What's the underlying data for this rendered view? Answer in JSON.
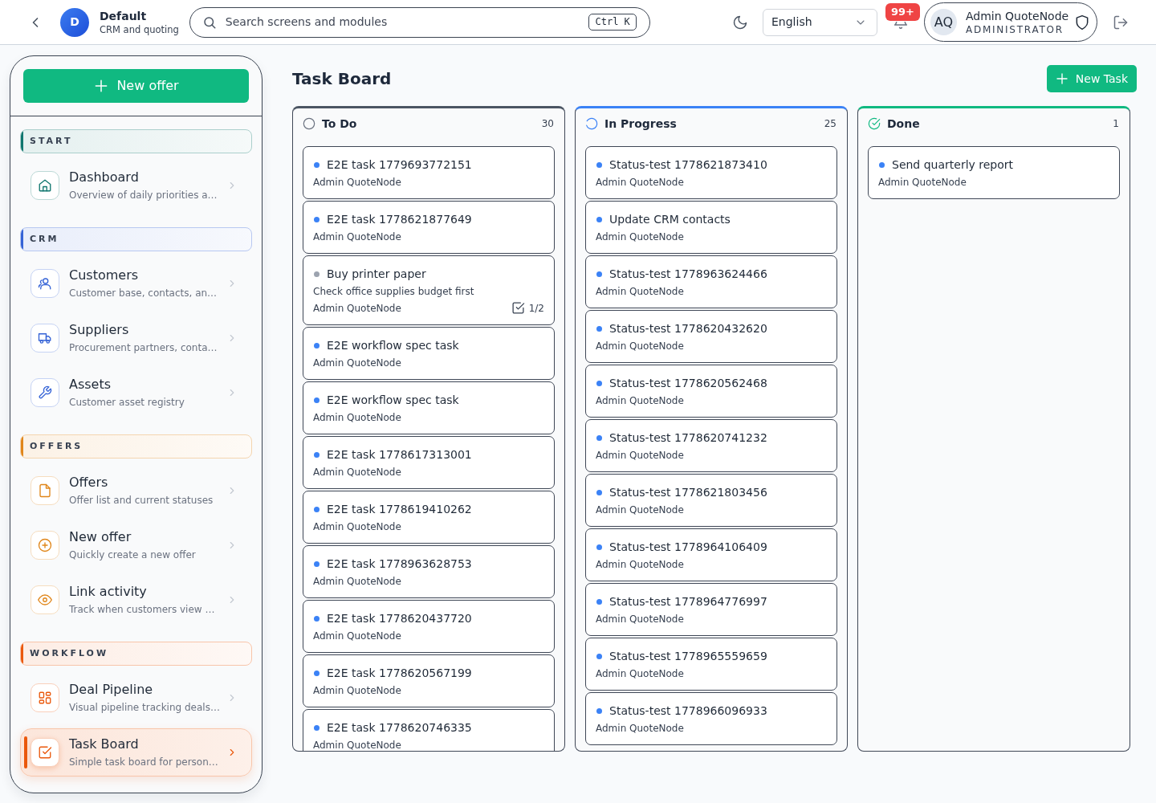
{
  "header": {
    "workspace": {
      "initial": "D",
      "name": "Default",
      "subtitle": "CRM and quoting"
    },
    "search": {
      "placeholder": "Search screens and modules",
      "shortcut": "Ctrl K"
    },
    "language": "English",
    "notification_badge": "99+",
    "user": {
      "initials": "AQ",
      "name": "Admin QuoteNode",
      "role": "ADMINISTRATOR"
    }
  },
  "sidebar": {
    "new_button": "New offer",
    "sections": [
      {
        "label": "START",
        "color": "#0f766e",
        "items": [
          {
            "title": "Dashboard",
            "subtitle": "Overview of daily priorities a…",
            "selected": false
          }
        ]
      },
      {
        "label": "CRM",
        "color": "#3563d6",
        "items": [
          {
            "title": "Customers",
            "subtitle": "Customer base, contacts, an…",
            "selected": false
          },
          {
            "title": "Suppliers",
            "subtitle": "Procurement partners, conta…",
            "selected": false
          },
          {
            "title": "Assets",
            "subtitle": "Customer asset registry",
            "selected": false
          }
        ]
      },
      {
        "label": "OFFERS",
        "color": "#e0861a",
        "items": [
          {
            "title": "Offers",
            "subtitle": "Offer list and current statuses",
            "selected": false
          },
          {
            "title": "New offer",
            "subtitle": "Quickly create a new offer",
            "selected": false
          },
          {
            "title": "Link activity",
            "subtitle": "Track when customers view …",
            "selected": false
          }
        ]
      },
      {
        "label": "WORKFLOW",
        "color": "#ea580c",
        "items": [
          {
            "title": "Deal Pipeline",
            "subtitle": "Visual pipeline tracking deals…",
            "selected": false
          },
          {
            "title": "Task Board",
            "subtitle": "Simple task board for person…",
            "selected": true
          }
        ]
      }
    ]
  },
  "page": {
    "title": "Task Board",
    "new_button": "New Task"
  },
  "board": {
    "columns": [
      {
        "kind": "todo",
        "title": "To Do",
        "count": "30",
        "color": "#4b5563",
        "tasks": [
          {
            "title": "E2E task 1779693772151",
            "color": "#3b82f6",
            "owner": "Admin QuoteNode"
          },
          {
            "title": "E2E task 1778621877649",
            "color": "#3b82f6",
            "owner": "Admin QuoteNode"
          },
          {
            "title": "Buy printer paper",
            "color": "#9ca3af",
            "description": "Check office supplies budget first",
            "owner": "Admin QuoteNode",
            "checklist": "1/2"
          },
          {
            "title": "E2E workflow spec task",
            "color": "#3b82f6",
            "owner": "Admin QuoteNode"
          },
          {
            "title": "E2E workflow spec task",
            "color": "#3b82f6",
            "owner": "Admin QuoteNode"
          },
          {
            "title": "E2E task 1778617313001",
            "color": "#3b82f6",
            "owner": "Admin QuoteNode"
          },
          {
            "title": "E2E task 1778619410262",
            "color": "#3b82f6",
            "owner": "Admin QuoteNode"
          },
          {
            "title": "E2E task 1778963628753",
            "color": "#3b82f6",
            "owner": "Admin QuoteNode"
          },
          {
            "title": "E2E task 1778620437720",
            "color": "#3b82f6",
            "owner": "Admin QuoteNode"
          },
          {
            "title": "E2E task 1778620567199",
            "color": "#3b82f6",
            "owner": "Admin QuoteNode"
          },
          {
            "title": "E2E task 1778620746335",
            "color": "#3b82f6",
            "owner": "Admin QuoteNode"
          }
        ]
      },
      {
        "kind": "progress",
        "title": "In Progress",
        "count": "25",
        "color": "#3b82f6",
        "tasks": [
          {
            "title": "Status-test 1778621873410",
            "color": "#3b82f6",
            "owner": "Admin QuoteNode"
          },
          {
            "title": "Update CRM contacts",
            "color": "#3b82f6",
            "owner": "Admin QuoteNode"
          },
          {
            "title": "Status-test 1778963624466",
            "color": "#3b82f6",
            "owner": "Admin QuoteNode"
          },
          {
            "title": "Status-test 1778620432620",
            "color": "#3b82f6",
            "owner": "Admin QuoteNode"
          },
          {
            "title": "Status-test 1778620562468",
            "color": "#3b82f6",
            "owner": "Admin QuoteNode"
          },
          {
            "title": "Status-test 1778620741232",
            "color": "#3b82f6",
            "owner": "Admin QuoteNode"
          },
          {
            "title": "Status-test 1778621803456",
            "color": "#3b82f6",
            "owner": "Admin QuoteNode"
          },
          {
            "title": "Status-test 1778964106409",
            "color": "#3b82f6",
            "owner": "Admin QuoteNode"
          },
          {
            "title": "Status-test 1778964776997",
            "color": "#3b82f6",
            "owner": "Admin QuoteNode"
          },
          {
            "title": "Status-test 1778965559659",
            "color": "#3b82f6",
            "owner": "Admin QuoteNode"
          },
          {
            "title": "Status-test 1778966096933",
            "color": "#3b82f6",
            "owner": "Admin QuoteNode"
          }
        ]
      },
      {
        "kind": "done",
        "title": "Done",
        "count": "1",
        "color": "#10b981",
        "tasks": [
          {
            "title": "Send quarterly report",
            "color": "#3b82f6",
            "owner": "Admin QuoteNode"
          }
        ]
      }
    ]
  }
}
